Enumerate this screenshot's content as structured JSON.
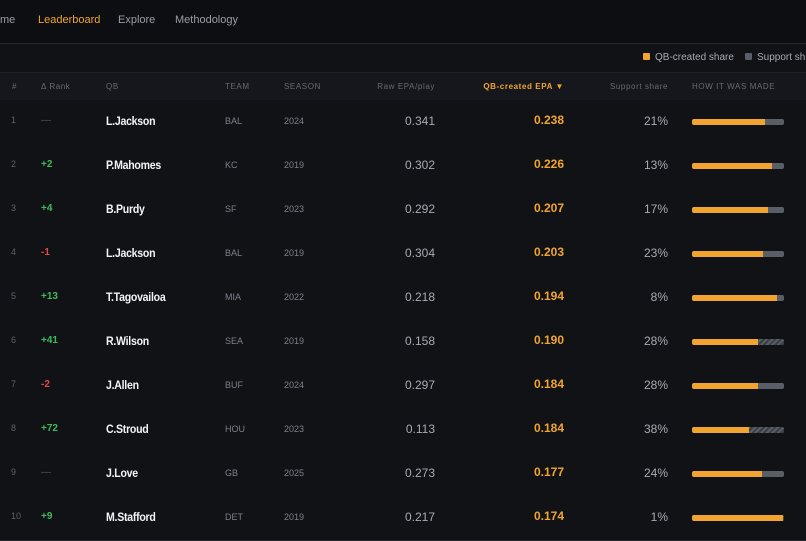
{
  "nav": {
    "items": [
      {
        "label": "me",
        "active": false
      },
      {
        "label": "Leaderboard",
        "active": true
      },
      {
        "label": "Explore",
        "active": false
      },
      {
        "label": "Methodology",
        "active": false
      }
    ]
  },
  "legend": {
    "qb_created": "QB-created share",
    "support": "Support sh",
    "colors": {
      "qb_created": "#f1a52e",
      "support": "#5a5e66"
    }
  },
  "table": {
    "headers": {
      "rank": "#",
      "delta": "Δ Rank",
      "qb": "QB",
      "team": "TEAM",
      "season": "SEASON",
      "raw": "Raw EPA/play",
      "qbepa": "QB-created EPA ▼",
      "support": "Support share",
      "how": "HOW IT WAS MADE"
    },
    "rows": [
      {
        "rank": "1",
        "delta": "—",
        "dir": "flat",
        "qb": "L.Jackson",
        "team": "BAL",
        "season": "2024",
        "raw": "0.341",
        "qbepa": "0.238",
        "support": "21%",
        "share": 0.79,
        "hatched": false
      },
      {
        "rank": "2",
        "delta": "+2",
        "dir": "up",
        "qb": "P.Mahomes",
        "team": "KC",
        "season": "2019",
        "raw": "0.302",
        "qbepa": "0.226",
        "support": "13%",
        "share": 0.87,
        "hatched": false
      },
      {
        "rank": "3",
        "delta": "+4",
        "dir": "up",
        "qb": "B.Purdy",
        "team": "SF",
        "season": "2023",
        "raw": "0.292",
        "qbepa": "0.207",
        "support": "17%",
        "share": 0.83,
        "hatched": false
      },
      {
        "rank": "4",
        "delta": "-1",
        "dir": "down",
        "qb": "L.Jackson",
        "team": "BAL",
        "season": "2019",
        "raw": "0.304",
        "qbepa": "0.203",
        "support": "23%",
        "share": 0.77,
        "hatched": false
      },
      {
        "rank": "5",
        "delta": "+13",
        "dir": "up",
        "qb": "T.Tagovailoa",
        "team": "MIA",
        "season": "2022",
        "raw": "0.218",
        "qbepa": "0.194",
        "support": "8%",
        "share": 0.92,
        "hatched": false
      },
      {
        "rank": "6",
        "delta": "+41",
        "dir": "up",
        "qb": "R.Wilson",
        "team": "SEA",
        "season": "2019",
        "raw": "0.158",
        "qbepa": "0.190",
        "support": "28%",
        "share": 0.72,
        "hatched": true
      },
      {
        "rank": "7",
        "delta": "-2",
        "dir": "down",
        "qb": "J.Allen",
        "team": "BUF",
        "season": "2024",
        "raw": "0.297",
        "qbepa": "0.184",
        "support": "28%",
        "share": 0.72,
        "hatched": false
      },
      {
        "rank": "8",
        "delta": "+72",
        "dir": "up",
        "qb": "C.Stroud",
        "team": "HOU",
        "season": "2023",
        "raw": "0.113",
        "qbepa": "0.184",
        "support": "38%",
        "share": 0.62,
        "hatched": true
      },
      {
        "rank": "9",
        "delta": "—",
        "dir": "flat",
        "qb": "J.Love",
        "team": "GB",
        "season": "2025",
        "raw": "0.273",
        "qbepa": "0.177",
        "support": "24%",
        "share": 0.76,
        "hatched": false
      },
      {
        "rank": "10",
        "delta": "+9",
        "dir": "up",
        "qb": "M.Stafford",
        "team": "DET",
        "season": "2019",
        "raw": "0.217",
        "qbepa": "0.174",
        "support": "1%",
        "share": 0.99,
        "hatched": true
      }
    ]
  }
}
